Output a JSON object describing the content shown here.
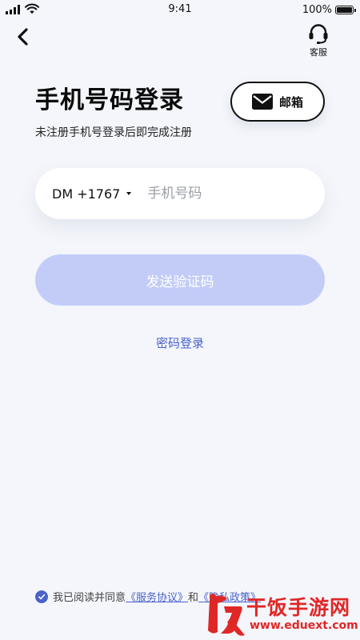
{
  "status_bar": {
    "time": "9:41",
    "battery_percent": "100%"
  },
  "header": {
    "support_label": "客服"
  },
  "title": "手机号码登录",
  "subtitle": "未注册手机号登录后即完成注册",
  "email_button_label": "邮箱",
  "phone": {
    "country_code": "DM +1767",
    "placeholder": "手机号码",
    "value": ""
  },
  "send_code_label": "发送验证码",
  "password_login_label": "密码登录",
  "agreement": {
    "prefix": "我已阅读并同意",
    "service_link": "《服务协议》",
    "joiner": "和",
    "privacy_link": "《隐私政策》",
    "checked": true
  },
  "watermark": {
    "title": "干饭手游网",
    "url": "www.eduext.com"
  },
  "colors": {
    "accent": "#4a62c9",
    "send_button_disabled": "#c3ccf7",
    "background": "#f4f6fb",
    "watermark_red": "#e02727"
  },
  "icons": {
    "back": "chevron-left-icon",
    "support": "headset-icon",
    "email": "envelope-icon",
    "check": "check-circle-icon"
  }
}
